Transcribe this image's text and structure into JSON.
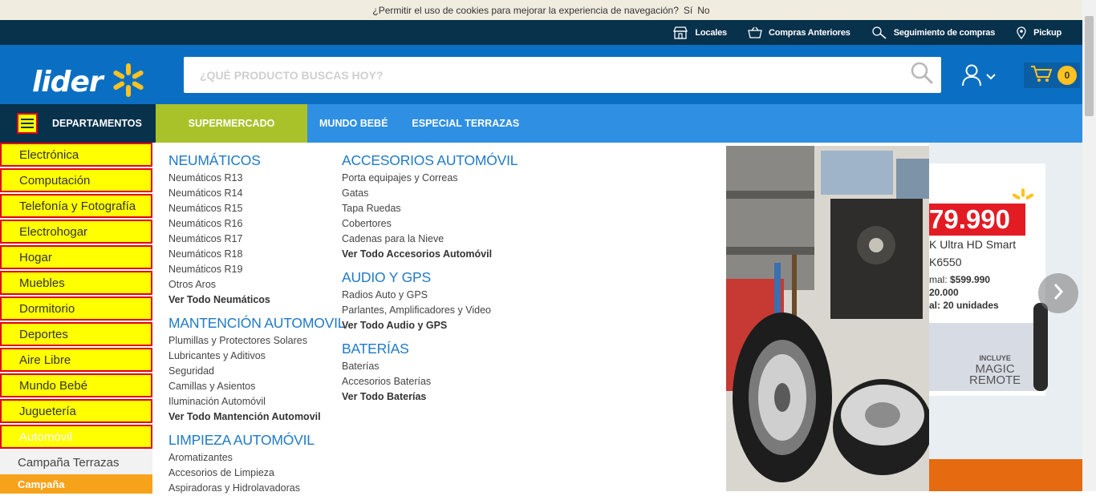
{
  "cookie_bar": {
    "text": "¿Permitir el uso de cookies para mejorar la experiencia de navegación?",
    "yes": "Sí",
    "no": "No"
  },
  "top_links": [
    {
      "label": "Locales",
      "icon": "store-icon"
    },
    {
      "label": "Compras Anteriores",
      "icon": "basket-icon"
    },
    {
      "label": "Seguimiento de compras",
      "icon": "tracking-icon"
    },
    {
      "label": "Pickup",
      "icon": "pickup-icon"
    }
  ],
  "header": {
    "logo_text": "lider",
    "search_placeholder": "¿QUÉ PRODUCTO BUSCAS HOY?",
    "cart_count": "0"
  },
  "nav": {
    "departments_label": "DEPARTAMENTOS",
    "links": [
      "SUPERMERCADO",
      "MUNDO BEBÉ",
      "ESPECIAL TERRAZAS"
    ]
  },
  "sidebar": {
    "categories": [
      "Electrónica",
      "Computación",
      "Telefonía y Fotografía",
      "Electrohogar",
      "Hogar",
      "Muebles",
      "Dormitorio",
      "Deportes",
      "Aire Libre",
      "Mundo Bebé",
      "Juguetería",
      "Automóvil"
    ],
    "active_index": 11,
    "extra": "Campaña Terrazas",
    "campaign": "Campaña"
  },
  "mega_menu": {
    "col1": [
      {
        "title": "NEUMÁTICOS",
        "items": [
          "Neumáticos R13",
          "Neumáticos R14",
          "Neumáticos R15",
          "Neumáticos R16",
          "Neumáticos R17",
          "Neumáticos R18",
          "Neumáticos R19",
          "Otros Aros"
        ],
        "all": "Ver Todo Neumáticos"
      },
      {
        "title": "MANTENCIÓN AUTOMOVIL",
        "items": [
          "Plumillas y Protectores Solares",
          "Lubricantes y Aditivos",
          "Seguridad",
          "Camillas y Asientos",
          "Iluminación Automóvil"
        ],
        "all": "Ver Todo Mantención Automovil"
      },
      {
        "title": "LIMPIEZA AUTOMÓVIL",
        "items": [
          "Aromatizantes",
          "Accesorios de Limpieza",
          "Aspiradoras y Hidrolavadoras"
        ],
        "all": ""
      }
    ],
    "col2": [
      {
        "title": "ACCESORIOS AUTOMÓVIL",
        "items": [
          "Porta equipajes y Correas",
          "Gatas",
          "Tapa Ruedas",
          "Cobertores",
          "Cadenas para la Nieve"
        ],
        "all": "Ver Todo Accesorios Automóvil"
      },
      {
        "title": "AUDIO Y GPS",
        "items": [
          "Radios Auto y GPS",
          "Parlantes, Amplificadores y Video"
        ],
        "all": "Ver Todo Audio y GPS"
      },
      {
        "title": "BATERÍAS",
        "items": [
          "Baterías",
          "Accesorios Baterías"
        ],
        "all": "Ver Todo Baterías"
      }
    ]
  },
  "banner": {
    "price": "79.990",
    "line1": "K Ultra HD Smart",
    "line2": "K6550",
    "normal_label": "mal:",
    "normal_price": "$599.990",
    "line3": "20.000",
    "stock": "al: 20 unidades",
    "badge_top": "INCLUYE",
    "badge_mid": "MAGIC",
    "badge_bot": "REMOTE"
  },
  "colors": {
    "brand_blue": "#0a6fc2",
    "dark_navy": "#08314c",
    "nav_blue": "#2f8fe3",
    "green": "#a9c22a",
    "yellow": "#ffc220",
    "highlight_yellow": "#ffff00",
    "highlight_red": "#e0001a"
  }
}
